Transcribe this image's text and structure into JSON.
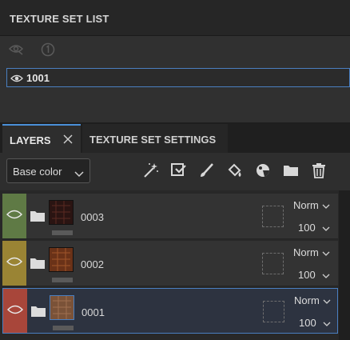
{
  "texture_set_list": {
    "title": "TEXTURE SET LIST",
    "icons": [
      "eye-visibility-icon",
      "number-one-icon"
    ],
    "items": [
      {
        "label": "1001"
      }
    ]
  },
  "layers_panel": {
    "tabs": [
      {
        "label": "LAYERS",
        "active": true,
        "close_icon": "close-icon"
      },
      {
        "label": "TEXTURE SET SETTINGS",
        "active": false
      }
    ],
    "channel_select": {
      "value": "Base color"
    },
    "tools": [
      "magic-wand-icon",
      "fill-layer-icon",
      "paint-brush-icon",
      "paint-bucket-icon",
      "smart-material-icon",
      "folder-icon",
      "trash-icon"
    ],
    "layers": [
      {
        "name": "0003",
        "blend": "Norm",
        "opacity": "100",
        "vis_color": "#5f7a45",
        "selected": false
      },
      {
        "name": "0002",
        "blend": "Norm",
        "opacity": "100",
        "vis_color": "#9a8434",
        "selected": false
      },
      {
        "name": "0001",
        "blend": "Norm",
        "opacity": "100",
        "vis_color": "#a8463a",
        "selected": true
      }
    ]
  }
}
